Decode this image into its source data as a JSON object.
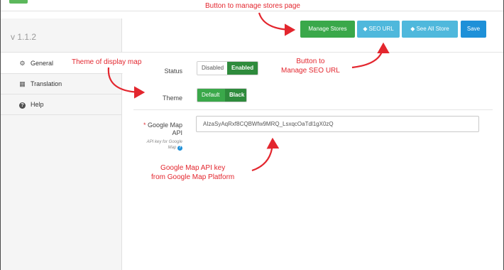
{
  "header": {
    "version": "v 1.1.2",
    "buttons": {
      "manage_stores": "Manage Stores",
      "seo_url": "SEO URL",
      "see_all_store": "See All Store",
      "save": "Save"
    }
  },
  "sidebar": {
    "items": [
      {
        "label": "General",
        "icon": "gear-icon",
        "active": true
      },
      {
        "label": "Translation",
        "icon": "translate-icon",
        "active": false
      },
      {
        "label": "Help",
        "icon": "question-icon",
        "active": false
      }
    ]
  },
  "form": {
    "status": {
      "label": "Status",
      "options": [
        "Disabled",
        "Enabled"
      ],
      "selected": "Enabled"
    },
    "theme": {
      "label": "Theme",
      "options": [
        "Default",
        "Black"
      ],
      "selected": "Black"
    },
    "google_map_api": {
      "required_mark": "*",
      "label_line1": "Google Map",
      "label_line2": "API",
      "sub_line1": "API key for Google",
      "sub_line2": "Map",
      "value": "AIzaSyAqRxf8CQBWfw9MRQ_LsxqcOaTdl1gX0zQ"
    }
  },
  "annotations": {
    "manage_stores": "Button to manage stores page",
    "theme": "Theme of display map",
    "seo_line1": "Button to",
    "seo_line2": "Manage SEO URL",
    "api_line1": "Google Map API key",
    "api_line2": "from Google Map Platform"
  },
  "colors": {
    "manage_btn": "#3aa84a",
    "seo_btn": "#4fb8dc",
    "save_btn": "#1e90d8",
    "enabled": "#2e8b3c",
    "annotation": "#e3262e"
  }
}
